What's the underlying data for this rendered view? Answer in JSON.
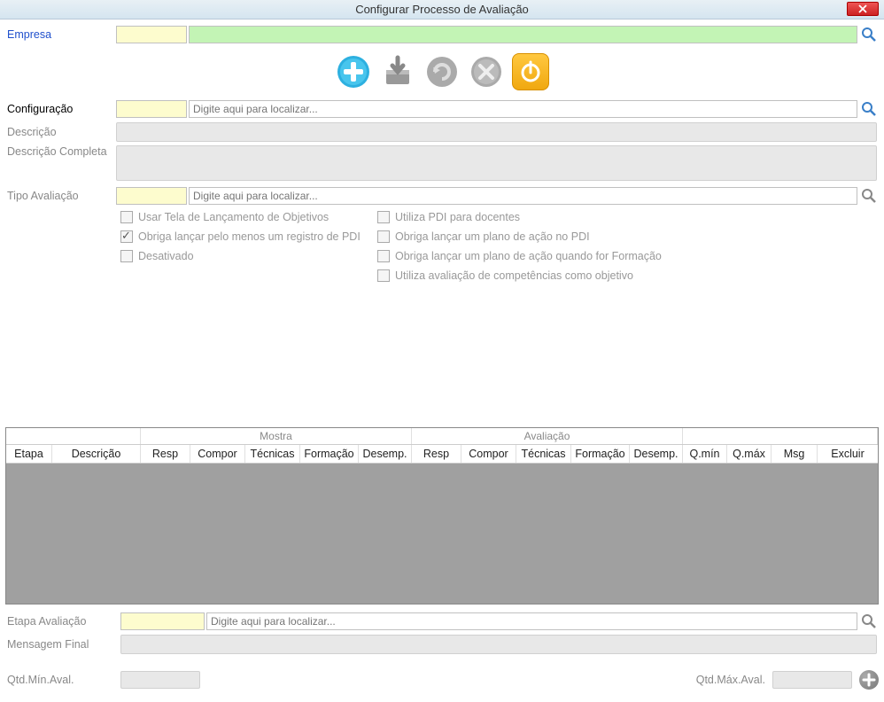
{
  "window": {
    "title": "Configurar Processo de Avaliação"
  },
  "labels": {
    "empresa": "Empresa",
    "configuracao": "Configuração",
    "descricao": "Descrição",
    "descricao_completa": "Descrição Completa",
    "tipo_avaliacao": "Tipo Avaliação",
    "etapa_avaliacao": "Etapa Avaliação",
    "mensagem_final": "Mensagem Final",
    "qtd_min": "Qtd.Mín.Aval.",
    "qtd_max": "Qtd.Máx.Aval."
  },
  "placeholders": {
    "localizar": "Digite aqui para localizar..."
  },
  "checkboxes": {
    "left": [
      {
        "label": "Usar Tela de Lançamento de Objetivos",
        "checked": false
      },
      {
        "label": "Obriga lançar pelo menos um registro de PDI",
        "checked": true
      },
      {
        "label": "Desativado",
        "checked": false
      }
    ],
    "right": [
      {
        "label": "Utiliza PDI para docentes",
        "checked": false
      },
      {
        "label": "Obriga lançar um plano de ação no PDI",
        "checked": false
      },
      {
        "label": "Obriga lançar um plano de ação quando for Formação",
        "checked": false
      },
      {
        "label": "Utiliza avaliação de competências como objetivo",
        "checked": false
      }
    ]
  },
  "table": {
    "groups": {
      "mostra": "Mostra",
      "avaliacao": "Avaliação"
    },
    "headers": {
      "etapa": "Etapa",
      "descricao": "Descrição",
      "resp1": "Resp",
      "compor1": "Compor",
      "tecnicas1": "Técnicas",
      "formacao1": "Formação",
      "desemp1": "Desemp.",
      "resp2": "Resp",
      "compor2": "Compor",
      "tecnicas2": "Técnicas",
      "formacao2": "Formação",
      "desemp2": "Desemp.",
      "qmin": "Q.mín",
      "qmax": "Q.máx",
      "msg": "Msg",
      "excluir": "Excluir"
    }
  }
}
